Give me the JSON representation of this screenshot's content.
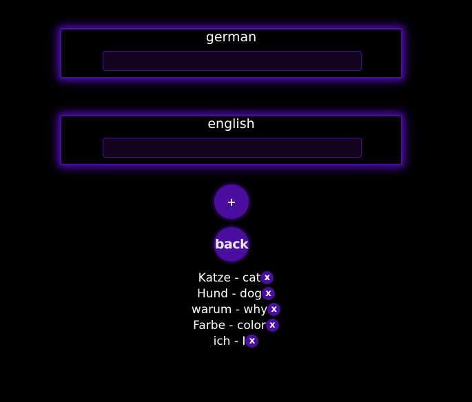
{
  "colors": {
    "background": "#000000",
    "accent": "#4a0e9e",
    "text": "#ffffff",
    "input_bg": "#13031f"
  },
  "form": {
    "german": {
      "label": "german",
      "value": "",
      "placeholder": ""
    },
    "english": {
      "label": "english",
      "value": "",
      "placeholder": ""
    }
  },
  "buttons": {
    "add_label": "+",
    "back_label": "back"
  },
  "vocabulary": [
    {
      "text": "Katze - cat",
      "delete_label": "x"
    },
    {
      "text": "Hund - dog",
      "delete_label": "x"
    },
    {
      "text": "warum - why",
      "delete_label": "x"
    },
    {
      "text": "Farbe - color",
      "delete_label": "x"
    },
    {
      "text": "ich - I",
      "delete_label": "x"
    }
  ]
}
